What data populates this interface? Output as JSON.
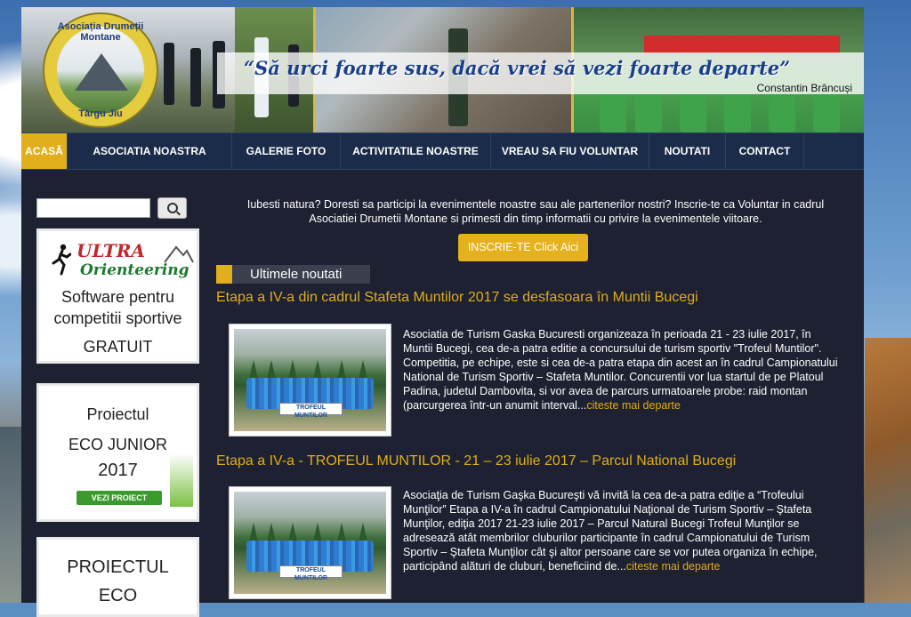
{
  "header": {
    "logo_top": "Asociația Drumeții Montane",
    "logo_bottom": "Târgu Jiu",
    "quote": "“Să urci foarte sus, dacă vrei să vezi foarte departe”",
    "author": "Constantin Brâncuși"
  },
  "nav": {
    "items": [
      "ACASĂ",
      "ASOCIATIA NOASTRA",
      "GALERIE FOTO",
      "ACTIVITATILE NOASTRE",
      "VREAU SA FIU VOLUNTAR",
      "NOUTATI",
      "CONTACT"
    ],
    "active": "ACASĂ"
  },
  "sidebar": {
    "search_placeholder": "",
    "card1": {
      "brand_title": "ULTRA",
      "brand_sub": "Orienteering",
      "line1": "Software pentru",
      "line2": "competitii sportive",
      "line3": "GRATUIT"
    },
    "card2": {
      "line1": "Proiectul",
      "line2": "ECO JUNIOR",
      "line3": "2017",
      "button": "VEZI PROIECT"
    },
    "card3": {
      "line1": "PROIECTUL",
      "line2": "ECO"
    }
  },
  "main": {
    "intro": "Iubesti natura? Doresti sa participi la evenimentele noastre sau ale partenerilor nostri? Inscrie-te ca Voluntar in cadrul Asociatiei Drumetii Montane si primesti din timp informatii cu privire la evenimentele viitoare.",
    "cta": "INSCRIE-TE Click Aici",
    "section_title": "Ultimele noutati",
    "articles": [
      {
        "title": "Etapa a IV-a din cadrul Stafeta Muntilor 2017 se desfasoara în Muntii Bucegi",
        "banner": "TROFEUL MUNTILOR",
        "body": "Asociatia de Turism Gaska Bucuresti organizeaza în perioada 21 - 23 iulie 2017, în Muntii Bucegi, cea de-a patra editie a concursului de turism sportiv \"Trofeul Muntilor\". Competitia, pe echipe, este si cea de-a patra etapa din acest an în cadrul Campionatului National de Turism Sportiv – Stafeta Muntilor. Concurentii vor lua startul de pe Platoul Padina, judetul Dambovita, si vor avea de parcurs urmatoarele probe: raid montan (parcurgerea într-un anumit interval...",
        "more": "citeste mai departe"
      },
      {
        "title": "Etapa a IV-a - TROFEUL MUNTILOR - 21 – 23 iulie 2017 – Parcul National Bucegi",
        "banner": "TROFEUL MUNTILOR",
        "body": "Asociaţia de Turism Gaşka Bucureşti vă invită la cea de-a patra ediţie a “Trofeului Munţilor” Etapa a IV-a în cadrul Campionatului Naţional de Turism Sportiv – Ştafeta Munţilor, ediţia 2017 21-23 iulie 2017 – Parcul Natural Bucegi Trofeul Munţilor se adresează atât membrilor cluburilor participante în cadrul Campionatului de Turism Sportiv – Ştafeta Munţilor cât şi altor persoane care se vor putea organiza în echipe, participând alături de cluburi, beneficiind de...",
        "more": "citeste mai departe"
      }
    ]
  }
}
